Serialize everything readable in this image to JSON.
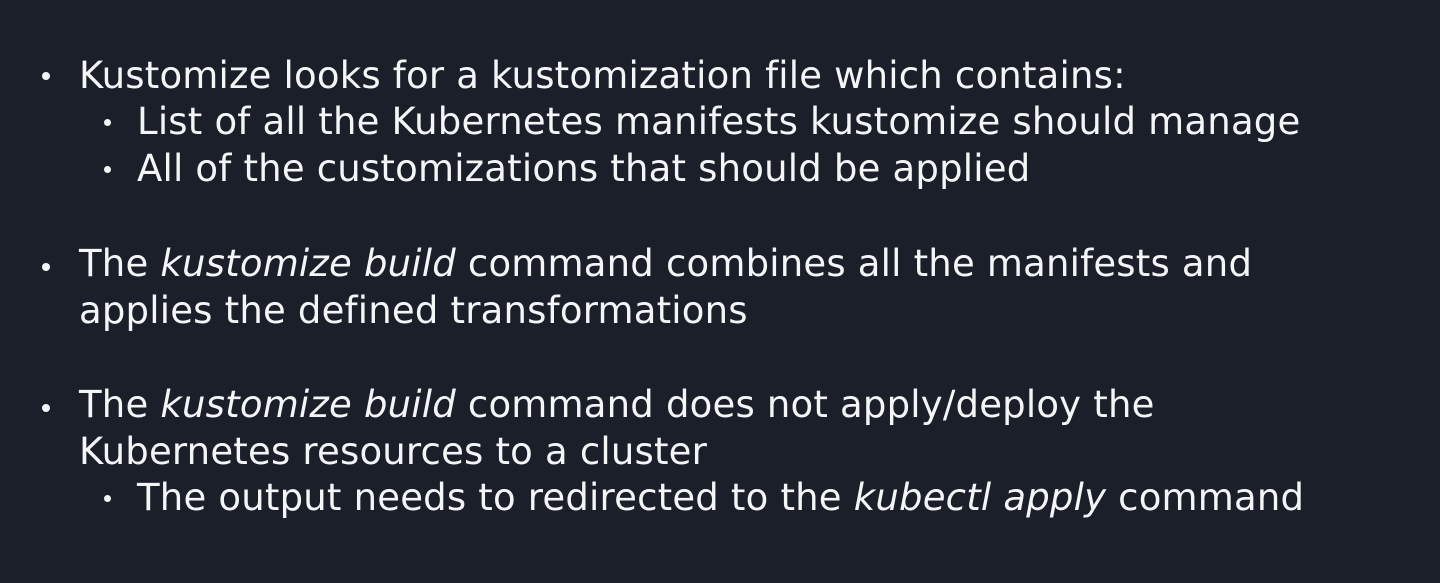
{
  "bullets": [
    {
      "text": "Kustomize looks for a kustomization file which contains:",
      "subitems": [
        "List of all the Kubernetes manifests kustomize should manage",
        "All of the customizations that should be applied"
      ]
    },
    {
      "prefix": "The ",
      "italic": "kustomize build",
      "line1_rest": " command combines all the manifests and",
      "line2": "applies the defined transformations"
    },
    {
      "prefix": "The ",
      "italic": "kustomize build",
      "line1_rest": " command does not apply/deploy the",
      "line2": "Kubernetes resources to a cluster",
      "subitem": {
        "prefix": "The output needs to redirected to the ",
        "italic": "kubectl apply",
        "suffix": " command"
      }
    }
  ]
}
